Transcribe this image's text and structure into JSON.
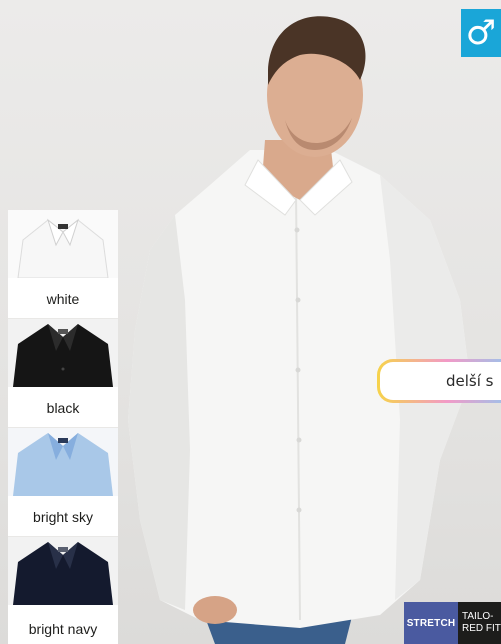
{
  "badge": {
    "symbol": "♂",
    "icon": "male-gender-icon",
    "color": "#1aa6d8"
  },
  "colors": [
    {
      "label": "white",
      "shirt_color": "#f7f7f7",
      "collar_shade": "#dcdcdc"
    },
    {
      "label": "black",
      "shirt_color": "#151515",
      "collar_shade": "#2c2c2c"
    },
    {
      "label": "bright sky",
      "shirt_color": "#a9c8e8",
      "collar_shade": "#86aede"
    },
    {
      "label": "bright navy",
      "shirt_color": "#141a2e",
      "collar_shade": "#283048"
    }
  ],
  "callout": {
    "text": "delší s"
  },
  "tags": {
    "stretch": "STRETCH",
    "fit_line1": "TAILO-",
    "fit_line2": "RED FIT"
  }
}
